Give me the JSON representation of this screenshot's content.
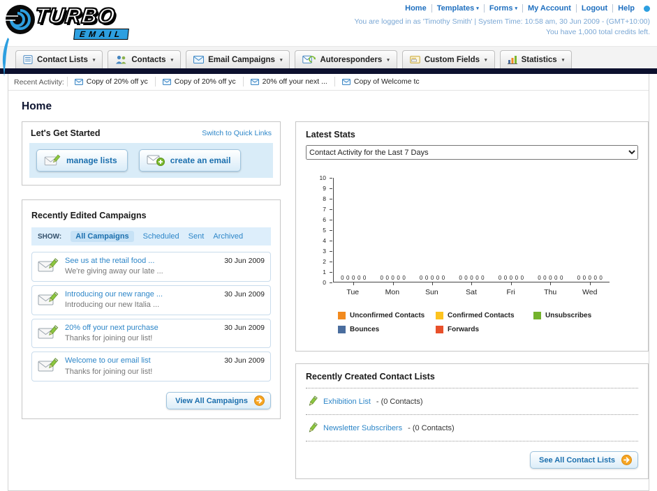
{
  "page_title": "Home",
  "header": {
    "logo": {
      "title": "TURBO",
      "subtitle": "EMAIL"
    },
    "nav_items": [
      {
        "label": "Home",
        "caret": false
      },
      {
        "label": "Templates",
        "caret": true
      },
      {
        "label": "Forms",
        "caret": true
      },
      {
        "label": "My Account",
        "caret": false
      },
      {
        "label": "Logout",
        "caret": false
      },
      {
        "label": "Help",
        "caret": false
      }
    ],
    "status_line": "You are logged in as 'Timothy Smith' | System Time: 10:58 am, 30 Jun 2009 - (GMT+10:00)",
    "credits_line": "You have 1,000 total credits left."
  },
  "main_nav": [
    {
      "label": "Contact Lists",
      "icon": "contact-lists-icon"
    },
    {
      "label": "Contacts",
      "icon": "contacts-icon"
    },
    {
      "label": "Email Campaigns",
      "icon": "email-campaigns-icon"
    },
    {
      "label": "Autoresponders",
      "icon": "autoresponders-icon"
    },
    {
      "label": "Custom Fields",
      "icon": "custom-fields-icon"
    },
    {
      "label": "Statistics",
      "icon": "statistics-icon"
    }
  ],
  "recent_activity": {
    "label": "Recent Activity:",
    "items": [
      "Copy of 20% off yc",
      "Copy of 20% off yc",
      "20% off your next ...",
      "Copy of Welcome tc"
    ]
  },
  "get_started": {
    "title": "Let's Get Started",
    "switch_link": "Switch to Quick Links",
    "buttons": [
      {
        "label": "manage lists",
        "icon": "pencil-envelope-icon"
      },
      {
        "label": "create an email",
        "icon": "new-email-icon"
      }
    ]
  },
  "campaigns": {
    "title": "Recently Edited Campaigns",
    "show_label": "SHOW:",
    "tabs": [
      "All Campaigns",
      "Scheduled",
      "Sent",
      "Archived"
    ],
    "selected_tab_index": 0,
    "items": [
      {
        "title": "See us at the retail food ...",
        "subtitle": "We're giving away our late ...",
        "date": "30 Jun 2009"
      },
      {
        "title": "Introducing our new range ...",
        "subtitle": "Introducing our new Italia ...",
        "date": "30 Jun 2009"
      },
      {
        "title": "20% off your next purchase",
        "subtitle": "Thanks for joining our list!",
        "date": "30 Jun 2009"
      },
      {
        "title": "Welcome to our email list",
        "subtitle": "Thanks for joining our list!",
        "date": "30 Jun 2009"
      }
    ],
    "view_all_label": "View All Campaigns"
  },
  "stats": {
    "title": "Latest Stats",
    "dropdown_value": "Contact Activity for the Last 7 Days",
    "chart_data": {
      "type": "bar",
      "title": "Contact Activity for the Last 7 Days",
      "categories": [
        "Tue",
        "Mon",
        "Sun",
        "Sat",
        "Fri",
        "Thu",
        "Wed"
      ],
      "series": [
        {
          "name": "Unconfirmed Contacts",
          "color": "#f28a1e",
          "values": [
            0,
            0,
            0,
            0,
            0,
            0,
            0
          ]
        },
        {
          "name": "Confirmed Contacts",
          "color": "#fdc31f",
          "values": [
            0,
            0,
            0,
            0,
            0,
            0,
            0
          ]
        },
        {
          "name": "Unsubscribes",
          "color": "#74b32c",
          "values": [
            0,
            0,
            0,
            0,
            0,
            0,
            0
          ]
        },
        {
          "name": "Bounces",
          "color": "#4a6d9e",
          "values": [
            0,
            0,
            0,
            0,
            0,
            0,
            0
          ]
        },
        {
          "name": "Forwards",
          "color": "#e8502a",
          "values": [
            0,
            0,
            0,
            0,
            0,
            0,
            0
          ]
        }
      ],
      "ylim": [
        0,
        10
      ],
      "yticks": [
        0,
        1,
        2,
        3,
        4,
        5,
        6,
        7,
        8,
        9,
        10
      ],
      "xlabel": "",
      "ylabel": "",
      "grid": false,
      "legend_position": "bottom"
    }
  },
  "contact_lists": {
    "title": "Recently Created Contact Lists",
    "items": [
      {
        "name": "Exhibition List",
        "count": "- (0 Contacts)"
      },
      {
        "name": "Newsletter Subscribers",
        "count": "- (0 Contacts)"
      }
    ],
    "see_all_label": "See All Contact Lists"
  }
}
